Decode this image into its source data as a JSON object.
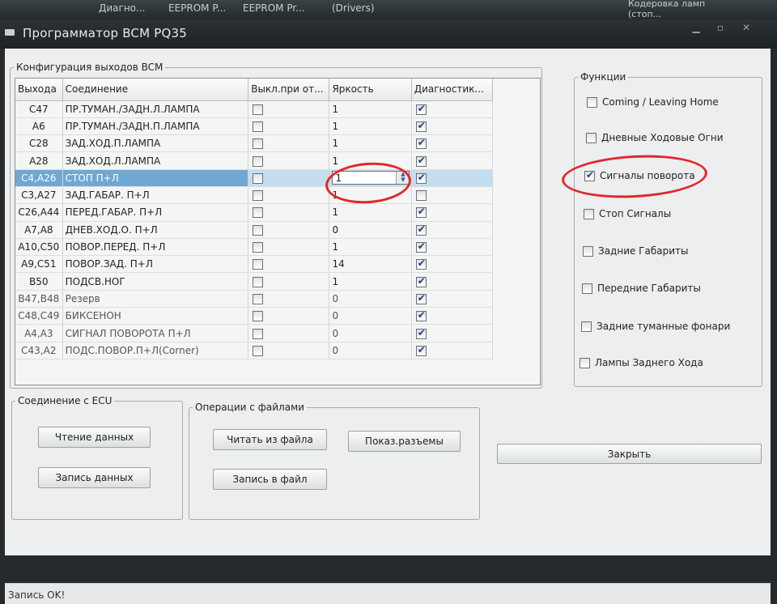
{
  "taskbar": {
    "items": [
      "Диагно...",
      "EEPROM P...",
      "EEPROM Pr...",
      "(Drivers)"
    ],
    "right": "Кодеровка ламп (стоп..."
  },
  "window": {
    "title": "Программатор BCM PQ35"
  },
  "config_group": {
    "title": "Конфигурация выходов BCM"
  },
  "table": {
    "headers": [
      "Выхода",
      "Соединение",
      "Выкл.при от...",
      "Яркость",
      "Диагностик..."
    ],
    "rows": [
      {
        "out": "C47",
        "conn": "ПР.ТУМАН./ЗАДН.Л.ЛАМПА",
        "off": false,
        "bright": "1",
        "diag": true
      },
      {
        "out": "A6",
        "conn": "ПР.ТУМАН./ЗАДН.П.ЛАМПА",
        "off": false,
        "bright": "1",
        "diag": true
      },
      {
        "out": "C28",
        "conn": "ЗАД.ХОД.П.ЛАМПА",
        "off": false,
        "bright": "1",
        "diag": true
      },
      {
        "out": "A28",
        "conn": "ЗАД.ХОД.Л.ЛАМПА",
        "off": false,
        "bright": "1",
        "diag": true
      },
      {
        "out": "C4,A26",
        "conn": "СТОП П+Л",
        "off": false,
        "bright": "1",
        "diag": true
      },
      {
        "out": "C3,A27",
        "conn": "ЗАД.ГАБАР. П+Л",
        "off": false,
        "bright": "1",
        "diag": false
      },
      {
        "out": "C26,A44",
        "conn": "ПЕРЕД.ГАБАР. П+Л",
        "off": false,
        "bright": "1",
        "diag": true
      },
      {
        "out": "A7,A8",
        "conn": "ДНЕВ.ХОД.О. П+Л",
        "off": false,
        "bright": "0",
        "diag": true
      },
      {
        "out": "A10,C50",
        "conn": "ПОВОР.ПЕРЕД. П+Л",
        "off": false,
        "bright": "1",
        "diag": true
      },
      {
        "out": "A9,C51",
        "conn": "ПОВОР.ЗАД. П+Л",
        "off": false,
        "bright": "14",
        "diag": true
      },
      {
        "out": "B50",
        "conn": "ПОДСВ.НОГ",
        "off": false,
        "bright": "1",
        "diag": true
      },
      {
        "out": "B47,B48",
        "conn": "Резерв",
        "off": false,
        "bright": "0",
        "diag": true
      },
      {
        "out": "C48,C49",
        "conn": "БИКСЕНОН",
        "off": false,
        "bright": "0",
        "diag": true
      },
      {
        "out": "A4,A3",
        "conn": "СИГНАЛ ПОВОРОТА П+Л",
        "off": false,
        "bright": "0",
        "diag": true
      },
      {
        "out": "C43,A2",
        "conn": "ПОДС.ПОВОР.П+Л(Corner)",
        "off": false,
        "bright": "0",
        "diag": true
      }
    ]
  },
  "functions": {
    "title": "Функции",
    "items": [
      {
        "label": "Coming / Leaving Home",
        "checked": false
      },
      {
        "label": "Дневные Ходовые Огни",
        "checked": false
      },
      {
        "label": "Сигналы поворота",
        "checked": true
      },
      {
        "label": "Стоп Сигналы",
        "checked": false
      },
      {
        "label": "Задние Габариты",
        "checked": false
      },
      {
        "label": "Передние Габариты",
        "checked": false
      },
      {
        "label": "Задние туманные фонари",
        "checked": false
      },
      {
        "label": "Лампы Заднего Хода",
        "checked": false
      }
    ]
  },
  "ecu": {
    "title": "Соединение с ECU",
    "read": "Чтение данных",
    "write": "Запись данных"
  },
  "files": {
    "title": "Операции с файлами",
    "read": "Читать из файла",
    "write": "Запись в файл",
    "pins": "Показ.разъемы"
  },
  "close": "Закрыть",
  "status": "Запись OK!"
}
